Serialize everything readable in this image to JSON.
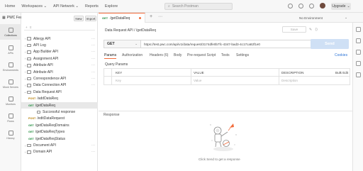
{
  "topbar": {
    "nav": [
      "Home",
      "Workspaces ⌄",
      "API Network ⌄",
      "Reports",
      "Explore"
    ],
    "search_placeholder": "Search Postman",
    "upgrade_label": "Upgrade"
  },
  "workspace": {
    "name": "PWC Feast",
    "new_label": "New",
    "import_label": "Import"
  },
  "rail": [
    {
      "label": "Collections",
      "icon": "collections-icon"
    },
    {
      "label": "APIs",
      "icon": "apis-icon"
    },
    {
      "label": "Environments",
      "icon": "environments-icon"
    },
    {
      "label": "Mock Servers",
      "icon": "mock-servers-icon"
    },
    {
      "label": "Monitors",
      "icon": "monitors-icon"
    },
    {
      "label": "Flows",
      "icon": "flows-icon"
    },
    {
      "label": "History",
      "icon": "history-icon"
    }
  ],
  "tree": [
    {
      "label": "Allergy API",
      "kind": "folder",
      "indent": 1
    },
    {
      "label": "API Log",
      "kind": "folder",
      "indent": 1
    },
    {
      "label": "App Builder API",
      "kind": "folder",
      "indent": 1
    },
    {
      "label": "Assignment API",
      "kind": "folder",
      "indent": 1
    },
    {
      "label": "Attribute API",
      "kind": "folder",
      "indent": 1
    },
    {
      "label": "Attribute API",
      "kind": "folder",
      "indent": 1
    },
    {
      "label": "Correspondence API",
      "kind": "folder",
      "indent": 1
    },
    {
      "label": "Data Connection API",
      "kind": "folder",
      "indent": 1
    },
    {
      "label": "Data Request API",
      "kind": "folder-open",
      "indent": 1
    },
    {
      "label": "/addDataReq",
      "kind": "req",
      "method": "POST",
      "indent": 2
    },
    {
      "label": "/getDataReq",
      "kind": "req",
      "method": "GET",
      "indent": 2,
      "selected": true
    },
    {
      "label": "Successful response",
      "kind": "example",
      "indent": 3
    },
    {
      "label": "/editDataRequest",
      "kind": "req",
      "method": "POST",
      "indent": 2
    },
    {
      "label": "/getDataReqDomains",
      "kind": "req",
      "method": "GET",
      "indent": 2
    },
    {
      "label": "/getDataReqTypes",
      "kind": "req",
      "method": "GET",
      "indent": 2
    },
    {
      "label": "/getDataReqStatus",
      "kind": "req",
      "method": "GET",
      "indent": 2
    },
    {
      "label": "Document API",
      "kind": "folder",
      "indent": 1
    },
    {
      "label": "Domain API",
      "kind": "folder",
      "indent": 1
    }
  ],
  "tab": {
    "method": "GET",
    "title": "/getDataReq"
  },
  "environment": "No Environment",
  "breadcrumb": "Data Request API / /getDataReq",
  "save_label": "Save",
  "request": {
    "method": "GET",
    "url": "https://test.pwc.com/api/v1/data/request/3174dfe0b7fc-4347-bad3-4c17ca82f1e0",
    "send_label": "Send",
    "tabs": [
      "Params",
      "Authorization",
      "Headers (6)",
      "Body",
      "Pre-request Script",
      "Tests",
      "Settings"
    ],
    "cookies_label": "Cookies",
    "query_params_title": "Query Params",
    "columns": [
      "KEY",
      "VALUE",
      "DESCRIPTION",
      "Bulk Edit"
    ],
    "placeholders": [
      "Key",
      "Value",
      "Description"
    ]
  },
  "response": {
    "title": "Response",
    "hint": "Click Send to get a response"
  }
}
